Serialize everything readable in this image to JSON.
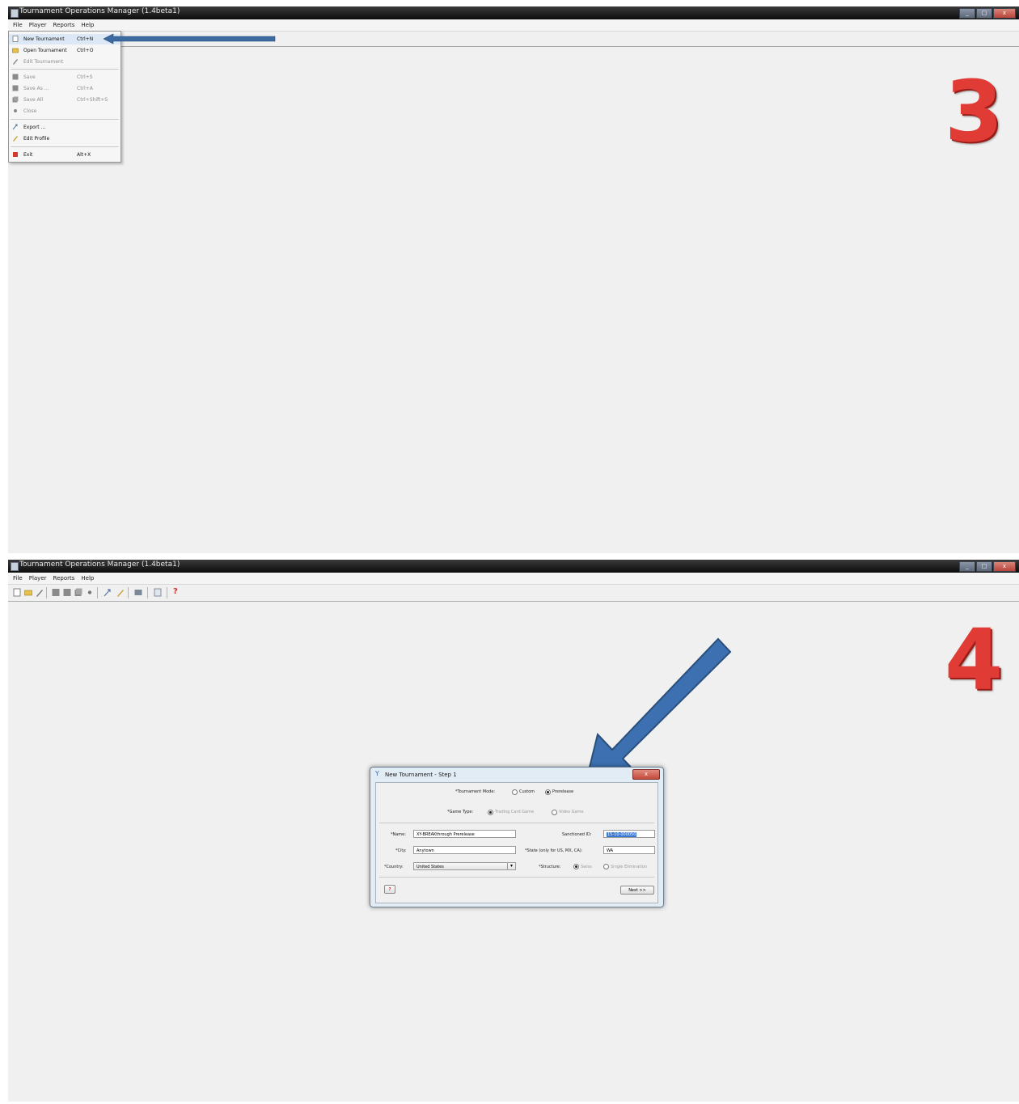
{
  "colors": {
    "step_number": "#e13b36",
    "arrow": "#3d70b0",
    "background": "#f0f0f0"
  },
  "step3": {
    "window_title": "Tournament Operations Manager (1.4beta1)",
    "menubar": [
      "File",
      "Player",
      "Reports",
      "Help"
    ],
    "file_menu": [
      {
        "label": "New Tournament",
        "shortcut": "Ctrl+N",
        "icon": "new-document-icon",
        "enabled": true
      },
      {
        "label": "Open Tournament",
        "shortcut": "Ctrl+O",
        "icon": "open-folder-icon",
        "enabled": true
      },
      {
        "label": "Edit Tournament",
        "shortcut": "",
        "icon": "edit-icon",
        "enabled": false
      },
      {
        "label": "Save",
        "shortcut": "Ctrl+S",
        "icon": "save-icon",
        "enabled": false
      },
      {
        "label": "Save As ...",
        "shortcut": "Ctrl+A",
        "icon": "save-as-icon",
        "enabled": false
      },
      {
        "label": "Save All",
        "shortcut": "Ctrl+Shift+S",
        "icon": "save-all-icon",
        "enabled": false
      },
      {
        "label": "Close",
        "shortcut": "",
        "icon": "close-icon",
        "enabled": false
      },
      {
        "label": "Export ...",
        "shortcut": "",
        "icon": "export-icon",
        "enabled": true
      },
      {
        "label": "Edit Profile",
        "shortcut": "",
        "icon": "profile-icon",
        "enabled": true
      },
      {
        "label": "Exit",
        "shortcut": "Alt+X",
        "icon": "exit-icon",
        "enabled": true
      }
    ],
    "step_number": "3"
  },
  "step4": {
    "window_title": "Tournament Operations Manager (1.4beta1)",
    "menubar": [
      "File",
      "Player",
      "Reports",
      "Help"
    ],
    "step_number": "4",
    "dialog": {
      "title": "New Tournament - Step 1",
      "tournament_mode_label": "*Tournament Mode:",
      "tournament_mode_options": [
        "Custom",
        "Prerelease"
      ],
      "tournament_mode_selected": "Prerelease",
      "game_type_label": "*Game Type:",
      "game_type_options": [
        "Trading Card Game",
        "Video Game"
      ],
      "game_type_selected": "Trading Card Game",
      "name_label": "*Name:",
      "name_value": "XY-BREAKthrough Prerelease",
      "sanctioned_id_label": "Sanctioned ID:",
      "sanctioned_id_value": "15-10-000050",
      "city_label": "*City:",
      "city_value": "Anytown",
      "state_label": "*State (only for US, MX, CA):",
      "state_value": "WA",
      "country_label": "*Country:",
      "country_value": "United States",
      "structure_label": "*Structure:",
      "structure_options": [
        "Swiss",
        "Single Elimination"
      ],
      "structure_selected": "Swiss",
      "help_button": "?",
      "next_button": "Next >>"
    }
  }
}
